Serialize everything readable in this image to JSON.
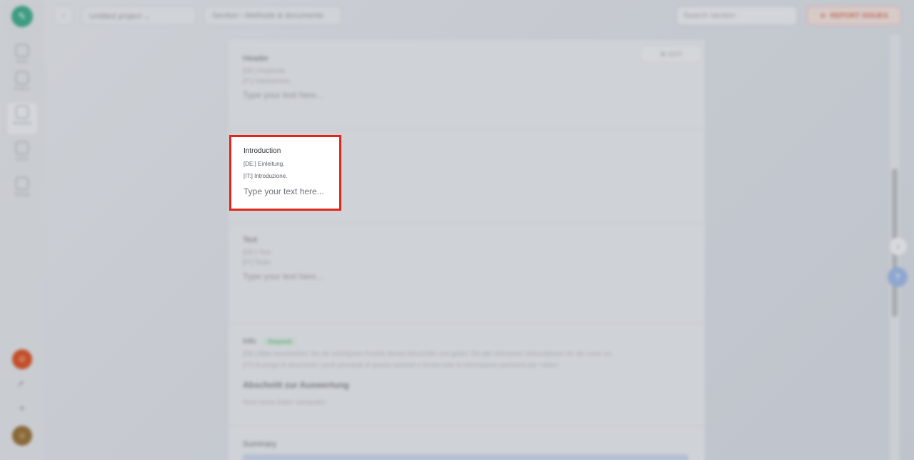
{
  "sidebar": {
    "logo_letter": "✎",
    "items": [
      {
        "label": "Home",
        "icon": "home-icon"
      },
      {
        "label": "Projects",
        "icon": "folder-icon"
      },
      {
        "label": "Templates",
        "icon": "template-icon"
      },
      {
        "label": "Library",
        "icon": "library-icon"
      },
      {
        "label": "Settings",
        "icon": "gear-icon"
      }
    ],
    "avatar_top": "O",
    "avatar_bottom": "U"
  },
  "topbar": {
    "back": "‹",
    "project_select": "Untitled project ⌄",
    "breadcrumb": "Section › Methods & documents",
    "search_placeholder": "Search section",
    "report_label": "REPORT ISSUES"
  },
  "document": {
    "edit_button": "⌘ EDIT",
    "header_section": {
      "title": "Header",
      "de": "[DE:] Kopfzeile.",
      "it": "[IT:] Intestazione.",
      "placeholder": "Type your text here..."
    },
    "introduction": {
      "title": "Introduction",
      "de": "[DE:] Einleitung.",
      "it": "[IT:] Introduzione.",
      "placeholder": "Type your text here..."
    },
    "text_section": {
      "title": "Text",
      "de": "[DE:] Text.",
      "it": "[IT:] Testo.",
      "placeholder": "Type your text here..."
    },
    "info_section": {
      "title": "Info",
      "badge": "Required",
      "line1": "[DE:] Bitte beschreiben Sie die wichtigsten Punkte dieses Abschnitts und geben Sie alle relevanten Informationen für die Leser an.",
      "line2": "[IT:] Si prega di descrivere i punti principali di questa sezione e fornire tutte le informazioni pertinenti per i lettori.",
      "bold": "Abschnitt zur Auswertung",
      "muted": "Noch keine Daten vorhanden"
    },
    "summary": {
      "title": "Summary"
    }
  },
  "rail": {
    "collapse": "‹",
    "help": "?"
  }
}
